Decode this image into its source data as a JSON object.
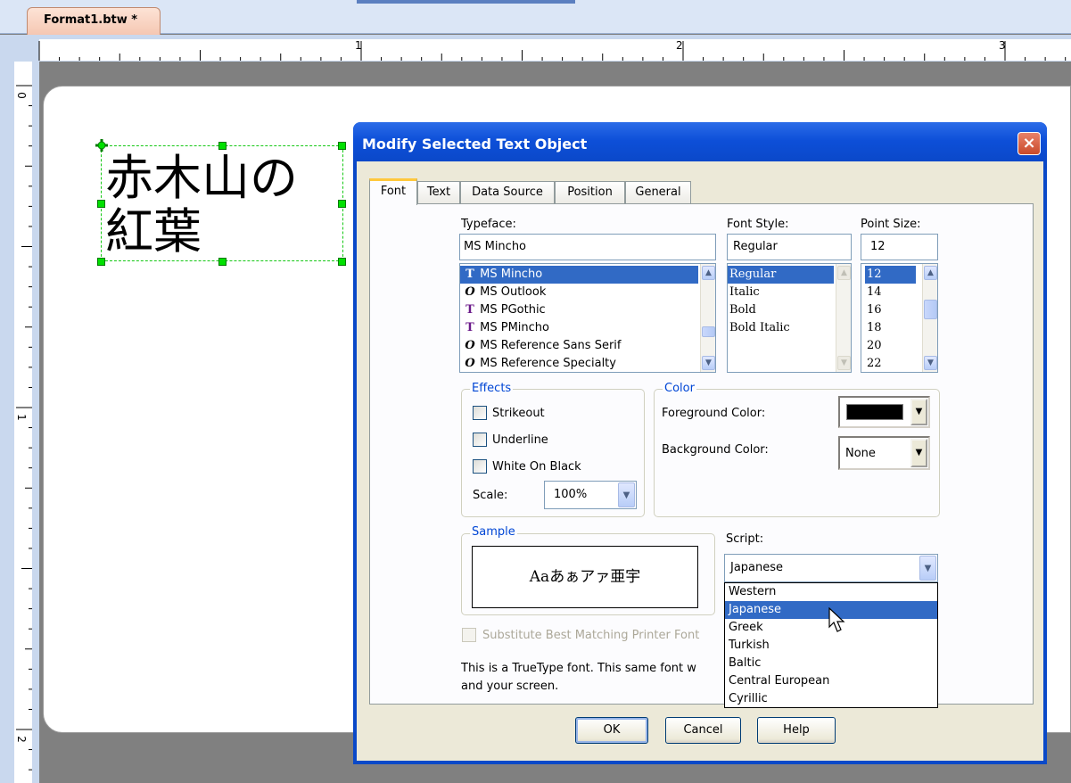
{
  "document_tab": {
    "label": "Format1.btw *"
  },
  "rulers": {
    "horizontal_numbers": [
      "1",
      "2",
      "3"
    ],
    "vertical_numbers": [
      "0",
      "1",
      "2"
    ]
  },
  "canvas": {
    "text_object": {
      "line1": "赤木山の",
      "line2": "紅葉"
    }
  },
  "dialog": {
    "title": "Modify Selected Text Object",
    "close_icon": "×",
    "tabs": [
      {
        "label": "Font",
        "active": true
      },
      {
        "label": "Text",
        "active": false
      },
      {
        "label": "Data Source",
        "active": false
      },
      {
        "label": "Position",
        "active": false
      },
      {
        "label": "General",
        "active": false
      }
    ],
    "typeface": {
      "label": "Typeface:",
      "value": "MS Mincho",
      "items": [
        {
          "label": "MS Mincho",
          "icon": "truetype-icon",
          "glyph": "T",
          "selected": true
        },
        {
          "label": "MS Outlook",
          "icon": "opentype-icon",
          "glyph": "O",
          "selected": false
        },
        {
          "label": "MS PGothic",
          "icon": "truetype-icon",
          "glyph": "T",
          "selected": false
        },
        {
          "label": "MS PMincho",
          "icon": "truetype-icon",
          "glyph": "T",
          "selected": false
        },
        {
          "label": "MS Reference Sans Serif",
          "icon": "opentype-icon",
          "glyph": "O",
          "selected": false
        },
        {
          "label": "MS Reference Specialty",
          "icon": "opentype-icon",
          "glyph": "O",
          "selected": false
        }
      ]
    },
    "font_style": {
      "label": "Font Style:",
      "value": "Regular",
      "items": [
        {
          "label": "Regular",
          "selected": true
        },
        {
          "label": "Italic",
          "selected": false
        },
        {
          "label": "Bold",
          "selected": false
        },
        {
          "label": "Bold Italic",
          "selected": false
        }
      ]
    },
    "point_size": {
      "label": "Point Size:",
      "value": "12",
      "items": [
        {
          "label": "12",
          "selected": true
        },
        {
          "label": "14",
          "selected": false
        },
        {
          "label": "16",
          "selected": false
        },
        {
          "label": "18",
          "selected": false
        },
        {
          "label": "20",
          "selected": false
        },
        {
          "label": "22",
          "selected": false
        }
      ]
    },
    "effects": {
      "label": "Effects",
      "strikeout": "Strikeout",
      "underline": "Underline",
      "white_on_black": "White On Black",
      "scale_label": "Scale:",
      "scale_value": "100%"
    },
    "color": {
      "label": "Color",
      "foreground_label": "Foreground Color:",
      "foreground_value": "#000000",
      "background_label": "Background Color:",
      "background_value": "None"
    },
    "sample": {
      "label": "Sample",
      "text": "Aaあぁアァ亜宇"
    },
    "script": {
      "label": "Script:",
      "value": "Japanese",
      "options": [
        {
          "label": "Western",
          "selected": false
        },
        {
          "label": "Japanese",
          "selected": true
        },
        {
          "label": "Greek",
          "selected": false
        },
        {
          "label": "Turkish",
          "selected": false
        },
        {
          "label": "Baltic",
          "selected": false
        },
        {
          "label": "Central European",
          "selected": false
        },
        {
          "label": "Cyrillic",
          "selected": false
        }
      ]
    },
    "substitute_label": "Substitute Best Matching Printer Font",
    "info_line1": "This is a TrueType font. This same font w",
    "info_line2": "and your screen.",
    "buttons": {
      "ok": "OK",
      "cancel": "Cancel",
      "help": "Help"
    }
  },
  "colors": {
    "title_bar": "#0a49c8",
    "selection": "#316ac5",
    "group_label": "#0046d5",
    "object_handle": "#00e000"
  }
}
